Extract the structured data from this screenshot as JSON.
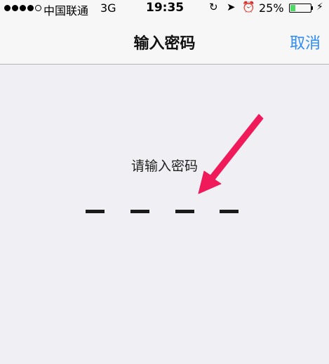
{
  "status_bar": {
    "carrier": "中国联通",
    "network": "3G",
    "time": "19:35",
    "battery_percent": "25%",
    "battery_level": 0.25,
    "signal_strength": 4,
    "signal_max": 5
  },
  "nav": {
    "title": "输入密码",
    "cancel_label": "取消"
  },
  "main": {
    "prompt": "请输入密码",
    "passcode_length": 4,
    "digits_entered": 0
  },
  "annotation": {
    "arrow_color": "#f0195a",
    "points_to": "passcode-slot-3"
  },
  "colors": {
    "accent": "#2f8bf6",
    "battery_green": "#4cd964",
    "background": "#efeff4"
  }
}
